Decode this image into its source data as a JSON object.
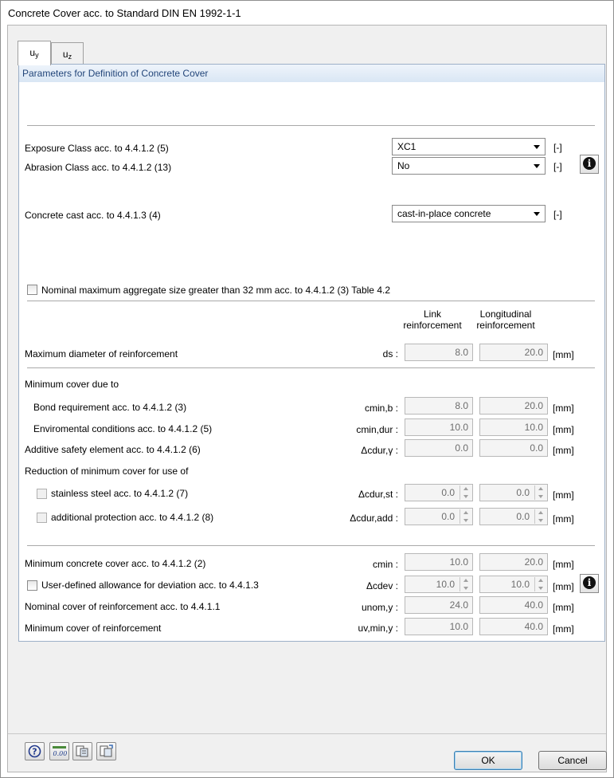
{
  "window": {
    "title": "Concrete Cover acc. to Standard DIN EN 1992-1-1"
  },
  "tabs": [
    {
      "label": "u",
      "sub": "y"
    },
    {
      "label": "u",
      "sub": "z"
    }
  ],
  "panel": {
    "header": "Parameters for Definition of Concrete Cover"
  },
  "exposure": {
    "label": "Exposure Class acc. to 4.4.1.2 (5)",
    "value": "XC1",
    "unit": "[-]"
  },
  "abrasion": {
    "label": "Abrasion Class acc. to 4.4.1.2 (13)",
    "value": "No",
    "unit": "[-]"
  },
  "cast": {
    "label": "Concrete cast acc. to 4.4.1.3 (4)",
    "value": "cast-in-place concrete",
    "unit": "[-]"
  },
  "aggregate": {
    "label": "Nominal maximum aggregate size greater than 32 mm acc. to  4.4.1.2 (3) Table 4.2"
  },
  "columns": {
    "link_line1": "Link",
    "link_line2": "reinforcement",
    "long_line1": "Longitudinal",
    "long_line2": "reinforcement"
  },
  "maxdiam": {
    "label": "Maximum diameter of reinforcement",
    "symbol": "ds :",
    "link": "8.0",
    "long": "20.0",
    "unit": "[mm]"
  },
  "mincover_heading": "Minimum cover due to",
  "bond": {
    "label": "Bond requirement acc. to 4.4.1.2 (3)",
    "symbol": "cmin,b :",
    "link": "8.0",
    "long": "20.0",
    "unit": "[mm]"
  },
  "environ": {
    "label": "Enviromental conditions acc. to 4.4.1.2 (5)",
    "symbol": "cmin,dur :",
    "link": "10.0",
    "long": "10.0",
    "unit": "[mm]"
  },
  "additive": {
    "label": "Additive safety element acc. to 4.4.1.2 (6)",
    "symbol": "Δcdur,γ :",
    "link": "0.0",
    "long": "0.0",
    "unit": "[mm]"
  },
  "reduction_heading": "Reduction of minimum cover for use of",
  "stainless": {
    "label": "stainless steel acc. to 4.4.1.2 (7)",
    "symbol": "Δcdur,st :",
    "link": "0.0",
    "long": "0.0",
    "unit": "[mm]"
  },
  "protection": {
    "label": "additional protection acc. to 4.4.1.2 (8)",
    "symbol": "Δcdur,add :",
    "link": "0.0",
    "long": "0.0",
    "unit": "[mm]"
  },
  "minconcrete": {
    "label": "Minimum concrete cover acc. to 4.4.1.2 (2)",
    "symbol": "cmin :",
    "link": "10.0",
    "long": "20.0",
    "unit": "[mm]"
  },
  "deviation": {
    "label": "User-defined allowance for deviation acc. to 4.4.1.3",
    "symbol": "Δcdev :",
    "link": "10.0",
    "long": "10.0",
    "unit": "[mm]"
  },
  "nominal": {
    "label": "Nominal cover of reinforcement acc. to 4.4.1.1",
    "symbol": "unom,y :",
    "link": "24.0",
    "long": "40.0",
    "unit": "[mm]"
  },
  "mincoverreinf": {
    "label": "Minimum cover of reinforcement",
    "symbol": "uv,min,y :",
    "link": "10.0",
    "long": "40.0",
    "unit": "[mm]"
  },
  "footer": {
    "ok": "OK",
    "cancel": "Cancel",
    "units_icon_text": "0.00"
  }
}
